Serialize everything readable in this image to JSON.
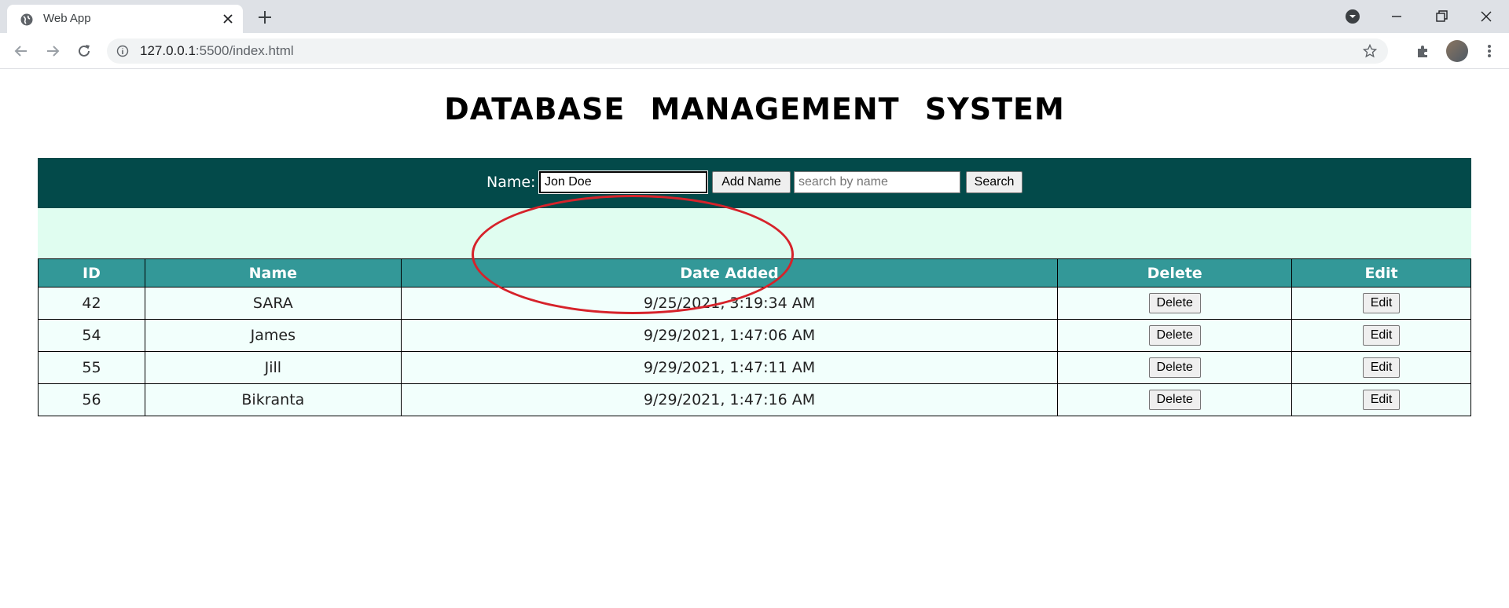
{
  "browser": {
    "tab_title": "Web App",
    "url_host": "127.0.0.1",
    "url_rest": ":5500/index.html"
  },
  "page": {
    "title": "DATABASE MANAGEMENT SYSTEM",
    "name_label": "Name:",
    "name_value": "Jon Doe",
    "add_button": "Add Name",
    "search_placeholder": "search by name",
    "search_button": "Search"
  },
  "table": {
    "headers": [
      "ID",
      "Name",
      "Date Added",
      "Delete",
      "Edit"
    ],
    "rows": [
      {
        "id": "42",
        "name": "SARA",
        "date": "9/25/2021, 3:19:34 AM",
        "delete": "Delete",
        "edit": "Edit"
      },
      {
        "id": "54",
        "name": "James",
        "date": "9/29/2021, 1:47:06 AM",
        "delete": "Delete",
        "edit": "Edit"
      },
      {
        "id": "55",
        "name": "Jill",
        "date": "9/29/2021, 1:47:11 AM",
        "delete": "Delete",
        "edit": "Edit"
      },
      {
        "id": "56",
        "name": "Bikranta",
        "date": "9/29/2021, 1:47:16 AM",
        "delete": "Delete",
        "edit": "Edit"
      }
    ]
  },
  "colors": {
    "toolbar_bg": "#034a4a",
    "mint_band": "#e0fdf0",
    "header_bg": "#339898",
    "annotation": "#d6222a"
  }
}
